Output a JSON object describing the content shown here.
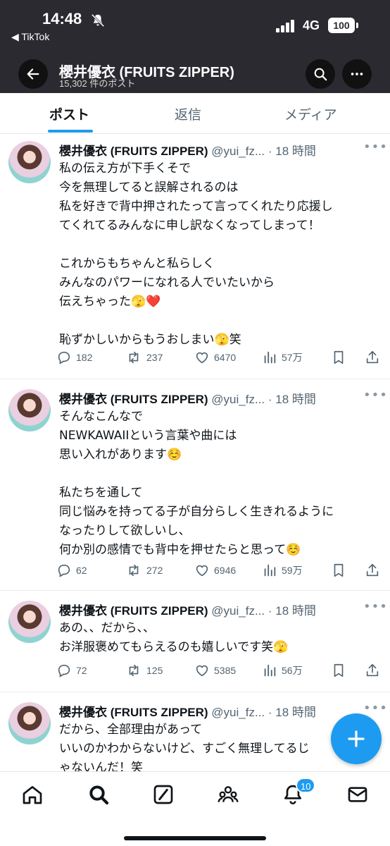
{
  "status": {
    "time": "14:48",
    "back_app": "◀ TikTok",
    "network": "4G",
    "battery": "100"
  },
  "header": {
    "title": "櫻井優衣 (FRUITS ZIPPER)",
    "post_count": "15,302 件のポスト"
  },
  "tabs": [
    {
      "label": "ポスト"
    },
    {
      "label": "返信"
    },
    {
      "label": "メディア"
    }
  ],
  "posts": [
    {
      "name": "櫻井優衣 (FRUITS ZIPPER)",
      "handle": "@yui_fz...",
      "time": "· 18 時間",
      "text": "私の伝え方が下手くそで\n今を無理してると誤解されるのは\n私を好きで背中押されたって言ってくれたり応援し\nてくれてるみんなに申し訳なくなってしまって！\n\nこれからもちゃんと私らしく\nみんなのパワーになれる人でいたいから\n伝えちゃった🫣❤️\n\n恥ずかしいからもうおしまい🫣笑",
      "replies": "182",
      "reposts": "237",
      "likes": "6470",
      "views": "57万"
    },
    {
      "name": "櫻井優衣 (FRUITS ZIPPER)",
      "handle": "@yui_fz...",
      "time": "· 18 時間",
      "text": "そんなこんなで\nNEWKAWAIIという言葉や曲には\n思い入れがあります☺️\n\n私たちを通して\n同じ悩みを持ってる子が自分らしく生きれるように\nなったりして欲しいし、\n何か別の感情でも背中を押せたらと思って☺️",
      "replies": "62",
      "reposts": "272",
      "likes": "6946",
      "views": "59万"
    },
    {
      "name": "櫻井優衣 (FRUITS ZIPPER)",
      "handle": "@yui_fz...",
      "time": "· 18 時間",
      "text": "あの、、だから、、\nお洋服褒めてもらえるのも嬉しいです笑🫣",
      "replies": "72",
      "reposts": "125",
      "likes": "5385",
      "views": "56万"
    },
    {
      "name": "櫻井優衣 (FRUITS ZIPPER)",
      "handle": "@yui_fz...",
      "time": "· 18 時間",
      "text": "だから、全部理由があって\nいいのかわからないけど、すごく無理してるじ\nゃないんだ！笑"
    }
  ],
  "nav": {
    "notifications_badge": "10"
  },
  "colors": {
    "accent": "#1d9bf0",
    "header_bg": "#2b2a31",
    "muted": "#536471"
  }
}
